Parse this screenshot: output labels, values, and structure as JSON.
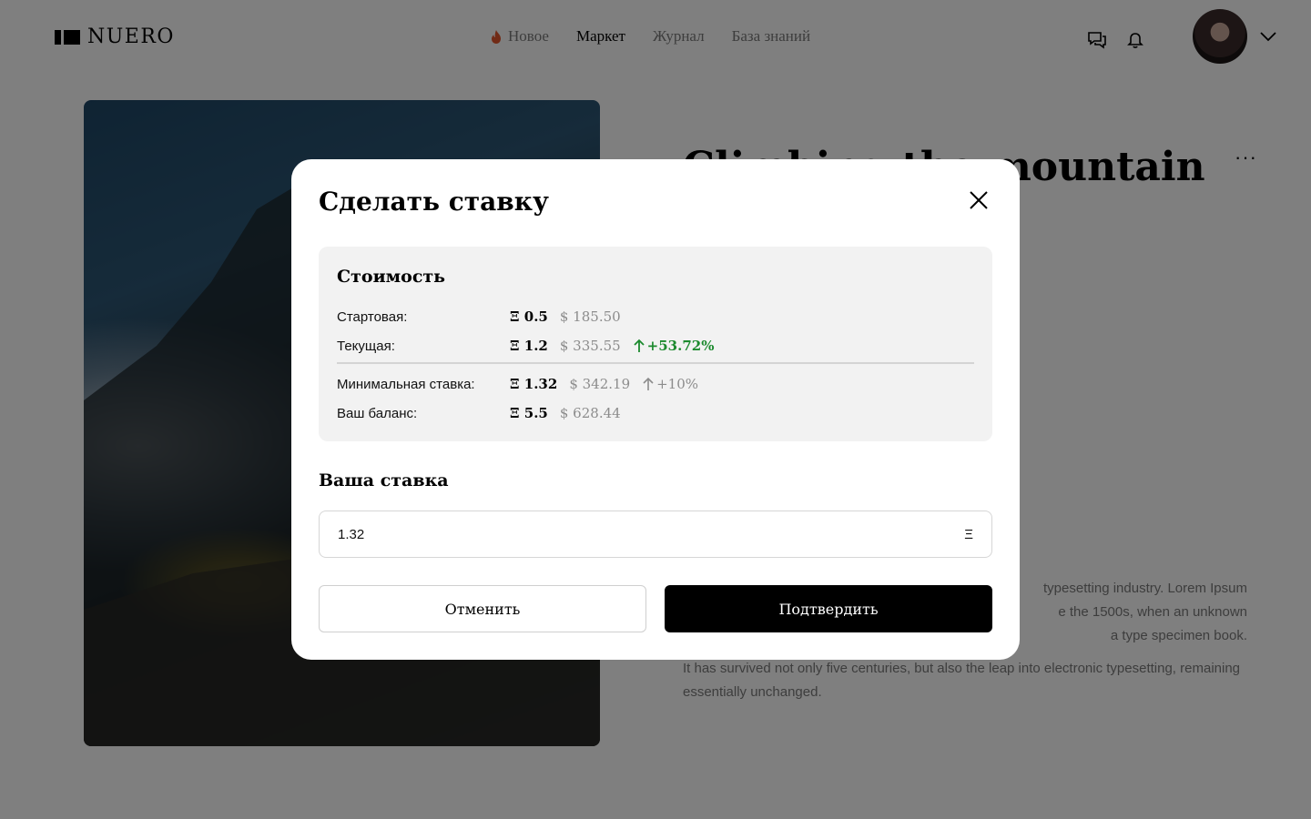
{
  "header": {
    "logo_text": "NUERO",
    "nav": [
      {
        "label": "Новое",
        "icon": "fire-icon"
      },
      {
        "label": "Маркет"
      },
      {
        "label": "Журнал"
      },
      {
        "label": "База знаний"
      }
    ],
    "active_nav": "Маркет"
  },
  "page": {
    "title": "Climbing the mountain",
    "more_label": "···",
    "description": [
      "typesetting industry. Lorem Ipsum",
      "e the 1500s, when an unknown",
      "a type specimen book."
    ],
    "description_2": "It has survived not only five centuries, but also the leap into electronic typesetting, remaining essentially unchanged."
  },
  "modal": {
    "title": "Сделать ставку",
    "cost": {
      "title": "Стоимость",
      "rows": [
        {
          "label": "Стартовая:",
          "eth": "Ξ 0.5",
          "usd": "$ 185.50",
          "change": ""
        },
        {
          "label": "Текущая:",
          "eth": "Ξ 1.2",
          "usd": "$ 335.55",
          "change": "+53.72%"
        },
        {
          "label": "Минимальная ставка:",
          "eth": "Ξ 1.32",
          "usd": "$ 342.19",
          "change": "+10%"
        },
        {
          "label": "Ваш баланс:",
          "eth": "Ξ 5.5",
          "usd": "$ 628.44",
          "change": ""
        }
      ]
    },
    "bid_label": "Ваша ставка",
    "bid_value": "1.32",
    "bid_currency": "Ξ",
    "cancel_label": "Отменить",
    "confirm_label": "Подтвердить"
  },
  "colors": {
    "accent_up": "#1c8a2e",
    "fire": "#e2562d",
    "overlay": "rgba(0,0,0,0.5)"
  }
}
